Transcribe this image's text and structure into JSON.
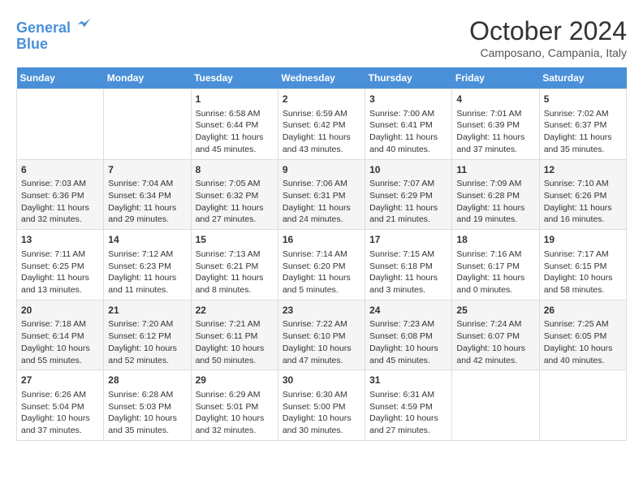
{
  "logo": {
    "line1": "General",
    "line2": "Blue"
  },
  "title": "October 2024",
  "location": "Camposano, Campania, Italy",
  "days_of_week": [
    "Sunday",
    "Monday",
    "Tuesday",
    "Wednesday",
    "Thursday",
    "Friday",
    "Saturday"
  ],
  "weeks": [
    [
      {
        "day": "",
        "sunrise": "",
        "sunset": "",
        "daylight": ""
      },
      {
        "day": "",
        "sunrise": "",
        "sunset": "",
        "daylight": ""
      },
      {
        "day": "1",
        "sunrise": "Sunrise: 6:58 AM",
        "sunset": "Sunset: 6:44 PM",
        "daylight": "Daylight: 11 hours and 45 minutes."
      },
      {
        "day": "2",
        "sunrise": "Sunrise: 6:59 AM",
        "sunset": "Sunset: 6:42 PM",
        "daylight": "Daylight: 11 hours and 43 minutes."
      },
      {
        "day": "3",
        "sunrise": "Sunrise: 7:00 AM",
        "sunset": "Sunset: 6:41 PM",
        "daylight": "Daylight: 11 hours and 40 minutes."
      },
      {
        "day": "4",
        "sunrise": "Sunrise: 7:01 AM",
        "sunset": "Sunset: 6:39 PM",
        "daylight": "Daylight: 11 hours and 37 minutes."
      },
      {
        "day": "5",
        "sunrise": "Sunrise: 7:02 AM",
        "sunset": "Sunset: 6:37 PM",
        "daylight": "Daylight: 11 hours and 35 minutes."
      }
    ],
    [
      {
        "day": "6",
        "sunrise": "Sunrise: 7:03 AM",
        "sunset": "Sunset: 6:36 PM",
        "daylight": "Daylight: 11 hours and 32 minutes."
      },
      {
        "day": "7",
        "sunrise": "Sunrise: 7:04 AM",
        "sunset": "Sunset: 6:34 PM",
        "daylight": "Daylight: 11 hours and 29 minutes."
      },
      {
        "day": "8",
        "sunrise": "Sunrise: 7:05 AM",
        "sunset": "Sunset: 6:32 PM",
        "daylight": "Daylight: 11 hours and 27 minutes."
      },
      {
        "day": "9",
        "sunrise": "Sunrise: 7:06 AM",
        "sunset": "Sunset: 6:31 PM",
        "daylight": "Daylight: 11 hours and 24 minutes."
      },
      {
        "day": "10",
        "sunrise": "Sunrise: 7:07 AM",
        "sunset": "Sunset: 6:29 PM",
        "daylight": "Daylight: 11 hours and 21 minutes."
      },
      {
        "day": "11",
        "sunrise": "Sunrise: 7:09 AM",
        "sunset": "Sunset: 6:28 PM",
        "daylight": "Daylight: 11 hours and 19 minutes."
      },
      {
        "day": "12",
        "sunrise": "Sunrise: 7:10 AM",
        "sunset": "Sunset: 6:26 PM",
        "daylight": "Daylight: 11 hours and 16 minutes."
      }
    ],
    [
      {
        "day": "13",
        "sunrise": "Sunrise: 7:11 AM",
        "sunset": "Sunset: 6:25 PM",
        "daylight": "Daylight: 11 hours and 13 minutes."
      },
      {
        "day": "14",
        "sunrise": "Sunrise: 7:12 AM",
        "sunset": "Sunset: 6:23 PM",
        "daylight": "Daylight: 11 hours and 11 minutes."
      },
      {
        "day": "15",
        "sunrise": "Sunrise: 7:13 AM",
        "sunset": "Sunset: 6:21 PM",
        "daylight": "Daylight: 11 hours and 8 minutes."
      },
      {
        "day": "16",
        "sunrise": "Sunrise: 7:14 AM",
        "sunset": "Sunset: 6:20 PM",
        "daylight": "Daylight: 11 hours and 5 minutes."
      },
      {
        "day": "17",
        "sunrise": "Sunrise: 7:15 AM",
        "sunset": "Sunset: 6:18 PM",
        "daylight": "Daylight: 11 hours and 3 minutes."
      },
      {
        "day": "18",
        "sunrise": "Sunrise: 7:16 AM",
        "sunset": "Sunset: 6:17 PM",
        "daylight": "Daylight: 11 hours and 0 minutes."
      },
      {
        "day": "19",
        "sunrise": "Sunrise: 7:17 AM",
        "sunset": "Sunset: 6:15 PM",
        "daylight": "Daylight: 10 hours and 58 minutes."
      }
    ],
    [
      {
        "day": "20",
        "sunrise": "Sunrise: 7:18 AM",
        "sunset": "Sunset: 6:14 PM",
        "daylight": "Daylight: 10 hours and 55 minutes."
      },
      {
        "day": "21",
        "sunrise": "Sunrise: 7:20 AM",
        "sunset": "Sunset: 6:12 PM",
        "daylight": "Daylight: 10 hours and 52 minutes."
      },
      {
        "day": "22",
        "sunrise": "Sunrise: 7:21 AM",
        "sunset": "Sunset: 6:11 PM",
        "daylight": "Daylight: 10 hours and 50 minutes."
      },
      {
        "day": "23",
        "sunrise": "Sunrise: 7:22 AM",
        "sunset": "Sunset: 6:10 PM",
        "daylight": "Daylight: 10 hours and 47 minutes."
      },
      {
        "day": "24",
        "sunrise": "Sunrise: 7:23 AM",
        "sunset": "Sunset: 6:08 PM",
        "daylight": "Daylight: 10 hours and 45 minutes."
      },
      {
        "day": "25",
        "sunrise": "Sunrise: 7:24 AM",
        "sunset": "Sunset: 6:07 PM",
        "daylight": "Daylight: 10 hours and 42 minutes."
      },
      {
        "day": "26",
        "sunrise": "Sunrise: 7:25 AM",
        "sunset": "Sunset: 6:05 PM",
        "daylight": "Daylight: 10 hours and 40 minutes."
      }
    ],
    [
      {
        "day": "27",
        "sunrise": "Sunrise: 6:26 AM",
        "sunset": "Sunset: 5:04 PM",
        "daylight": "Daylight: 10 hours and 37 minutes."
      },
      {
        "day": "28",
        "sunrise": "Sunrise: 6:28 AM",
        "sunset": "Sunset: 5:03 PM",
        "daylight": "Daylight: 10 hours and 35 minutes."
      },
      {
        "day": "29",
        "sunrise": "Sunrise: 6:29 AM",
        "sunset": "Sunset: 5:01 PM",
        "daylight": "Daylight: 10 hours and 32 minutes."
      },
      {
        "day": "30",
        "sunrise": "Sunrise: 6:30 AM",
        "sunset": "Sunset: 5:00 PM",
        "daylight": "Daylight: 10 hours and 30 minutes."
      },
      {
        "day": "31",
        "sunrise": "Sunrise: 6:31 AM",
        "sunset": "Sunset: 4:59 PM",
        "daylight": "Daylight: 10 hours and 27 minutes."
      },
      {
        "day": "",
        "sunrise": "",
        "sunset": "",
        "daylight": ""
      },
      {
        "day": "",
        "sunrise": "",
        "sunset": "",
        "daylight": ""
      }
    ]
  ]
}
